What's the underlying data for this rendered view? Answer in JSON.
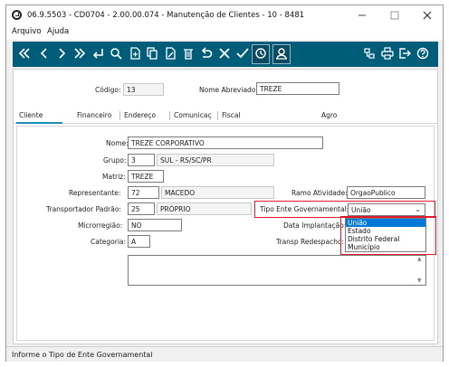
{
  "window": {
    "title": "06.9.5503 - CD0704 - 2.00.00.074 - Manutenção de Clientes - 10 - 8481"
  },
  "menu": [
    "Arquivo",
    "Ajuda"
  ],
  "toolbar_icons": [
    "first-record-icon",
    "previous-record-icon",
    "next-record-icon",
    "last-record-icon",
    "enter-icon",
    "search-icon",
    "new-icon",
    "copy-icon",
    "edit-icon",
    "delete-icon",
    "undo-icon",
    "cancel-icon",
    "confirm-icon",
    "history-icon",
    "user-icon",
    "export-icon",
    "print-icon",
    "exit-icon",
    "help-icon"
  ],
  "header": {
    "codigo_label": "Código:",
    "codigo_value": "13",
    "nome_abreviado_label": "Nome Abreviado:",
    "nome_abreviado_value": "TREZE"
  },
  "tabs": [
    "Cliente",
    "Financeiro",
    "Endereço",
    "Comunicaç",
    "Fiscal",
    "Agro"
  ],
  "form": {
    "nome_label": "Nome:",
    "nome_value": "TREZE CORPORATIVO",
    "grupo_label": "Grupo:",
    "grupo_code": "3",
    "grupo_desc": "SUL - RS/SC/PR",
    "matriz_label": "Matriz:",
    "matriz_value": "TREZE",
    "representante_label": "Representante:",
    "representante_code": "72",
    "representante_desc": "MACEDO",
    "transportador_label": "Transportador Padrão:",
    "transportador_code": "25",
    "transportador_desc": "PRÓPRIO",
    "microrregiao_label": "Microrregião:",
    "microrregiao_value": "NO",
    "categoria_label": "Categoria:",
    "categoria_value": "A",
    "ramo_label": "Ramo Atividade:",
    "ramo_value": "OrgaoPublico",
    "tipo_ente_label": "Tipo Ente Governamental:",
    "tipo_ente_value": "União",
    "data_implantacao_label": "Data Implantação:",
    "transp_redespacho_label": "Transp Redespacho:"
  },
  "dropdown_options": [
    "União",
    "Estado",
    "Distrito Federal",
    "Município"
  ],
  "status": "Informe o Tipo de Ente Governamental",
  "colors": {
    "toolbar": "#005d7a",
    "highlight_box": "#e0182c",
    "selected_option": "#0078d7",
    "active_tab": "#1c8fb8"
  }
}
